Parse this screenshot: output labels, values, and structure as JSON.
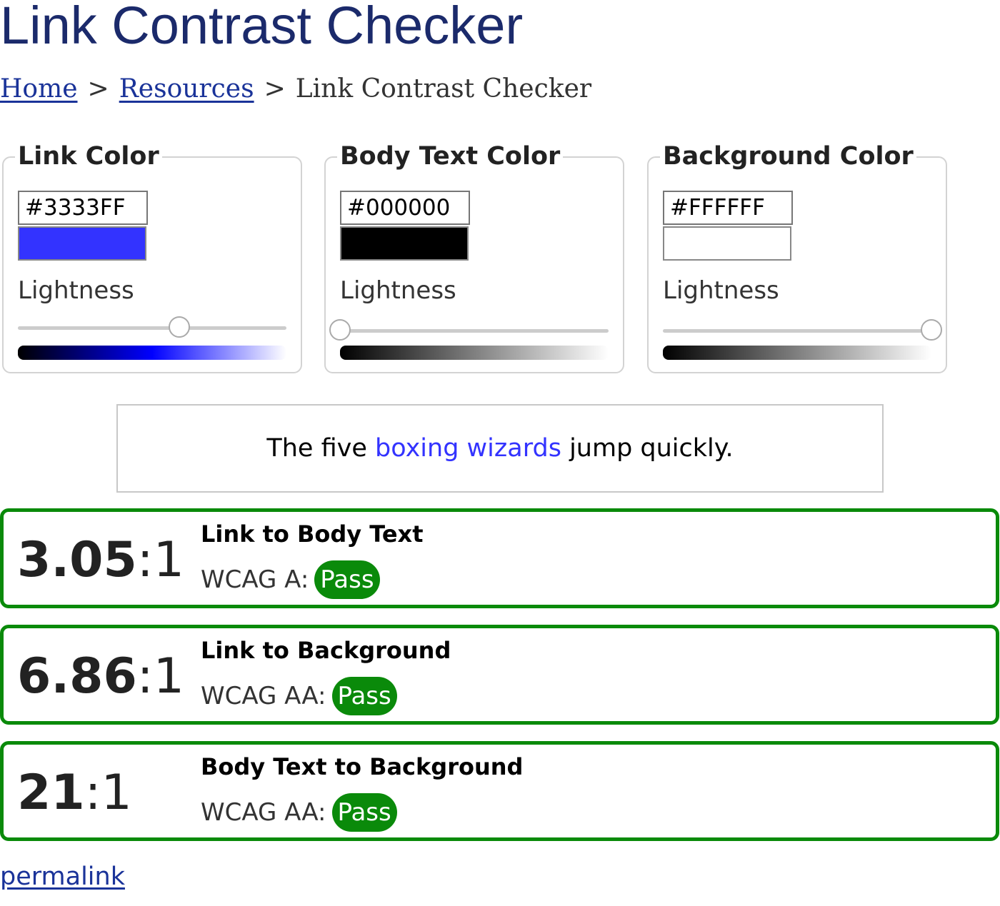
{
  "page": {
    "title": "Link Contrast Checker"
  },
  "breadcrumb": {
    "home": "Home",
    "resources": "Resources",
    "current": "Link Contrast Checker",
    "separator": ">"
  },
  "pickers": [
    {
      "legend": "Link Color",
      "hex": "#3333FF",
      "swatch_color": "#3333ff",
      "lightness_label": "Lightness",
      "lightness_fraction": 0.6
    },
    {
      "legend": "Body Text Color",
      "hex": "#000000",
      "swatch_color": "#000000",
      "lightness_label": "Lightness",
      "lightness_fraction": 0.0
    },
    {
      "legend": "Background Color",
      "hex": "#FFFFFF",
      "swatch_color": "#ffffff",
      "lightness_label": "Lightness",
      "lightness_fraction": 1.0
    }
  ],
  "preview": {
    "before": "The five ",
    "link": "boxing wizards",
    "after": " jump quickly."
  },
  "results": [
    {
      "ratio": "3.05",
      "suffix": ":1",
      "title": "Link to Body Text",
      "level": "WCAG A:",
      "status": "Pass"
    },
    {
      "ratio": "6.86",
      "suffix": ":1",
      "title": "Link to Background",
      "level": "WCAG AA:",
      "status": "Pass"
    },
    {
      "ratio": "21",
      "suffix": ":1",
      "title": "Body Text to Background",
      "level": "WCAG AA:",
      "status": "Pass"
    }
  ],
  "permalink": "permalink",
  "colors": {
    "title": "#1b2a6b",
    "link": "#3333ff",
    "pass": "#0a8a0a"
  }
}
